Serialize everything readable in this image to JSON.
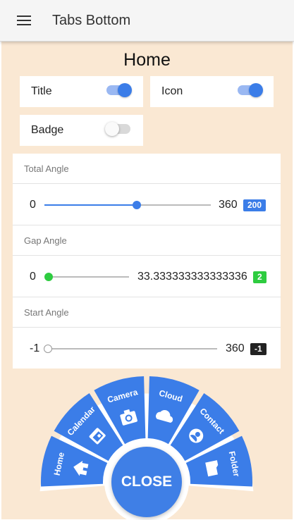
{
  "app": {
    "title": "Tabs Bottom"
  },
  "page": {
    "title": "Home"
  },
  "toggles": {
    "title": {
      "label": "Title",
      "on": true
    },
    "icon": {
      "label": "Icon",
      "on": true
    },
    "badge": {
      "label": "Badge",
      "on": false
    }
  },
  "sliders": {
    "total_angle": {
      "label": "Total Angle",
      "min": "0",
      "max": "360",
      "value": "200",
      "fraction": 0.556
    },
    "gap_angle": {
      "label": "Gap Angle",
      "min": "0",
      "max": "33.333333333333336",
      "value": "2",
      "fraction": 0.0
    },
    "start_angle": {
      "label": "Start Angle",
      "min": "-1",
      "max": "360",
      "value": "-1",
      "fraction": 0.0
    }
  },
  "fab": {
    "items": [
      "Home",
      "Calendar",
      "Camera",
      "Cloud",
      "Contact",
      "Folder"
    ],
    "close_label": "CLOSE"
  },
  "colors": {
    "accent_blue": "#3b7de8",
    "green": "#2ecc40",
    "dark": "#222222",
    "background": "#fae8d3"
  }
}
